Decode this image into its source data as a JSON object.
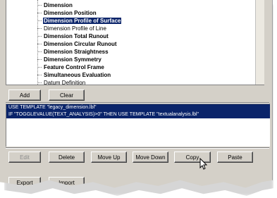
{
  "tree": {
    "items": [
      {
        "label": "Dimension",
        "bold": true,
        "selected": false
      },
      {
        "label": "Dimension Position",
        "bold": true,
        "selected": false
      },
      {
        "label": "Dimension Profile of Surface",
        "bold": true,
        "selected": true
      },
      {
        "label": "Dimension Profile of Line",
        "bold": false,
        "selected": false
      },
      {
        "label": "Dimension Total Runout",
        "bold": true,
        "selected": false
      },
      {
        "label": "Dimension Circular Runout",
        "bold": true,
        "selected": false
      },
      {
        "label": "Dimension Straightness",
        "bold": true,
        "selected": false
      },
      {
        "label": "Dimension Symmetry",
        "bold": true,
        "selected": false
      },
      {
        "label": "Feature Control Frame",
        "bold": true,
        "selected": false
      },
      {
        "label": "Simultaneous Evaluation",
        "bold": true,
        "selected": false
      },
      {
        "label": "Datum Definition",
        "bold": false,
        "selected": false
      }
    ]
  },
  "top_buttons": {
    "add": "Add",
    "clear": "Clear"
  },
  "templates": [
    "USE TEMPLATE \"legacy_dimension.lbl\"",
    "IF \"TOGGLEVALUE(TEXT_ANALYSIS)>0\" THEN USE TEMPLATE \"textualanalysis.lbl\""
  ],
  "edit_buttons": {
    "edit": "Edit",
    "delete": "Delete",
    "move_up": "Move Up",
    "move_down": "Move Down",
    "copy": "Copy",
    "paste": "Paste"
  },
  "io_buttons": {
    "export": "Export",
    "import": "Import"
  },
  "colors": {
    "selection": "#0a246a",
    "face": "#d4d0c8"
  },
  "icons": {
    "cursor": "mouse-pointer-icon"
  }
}
